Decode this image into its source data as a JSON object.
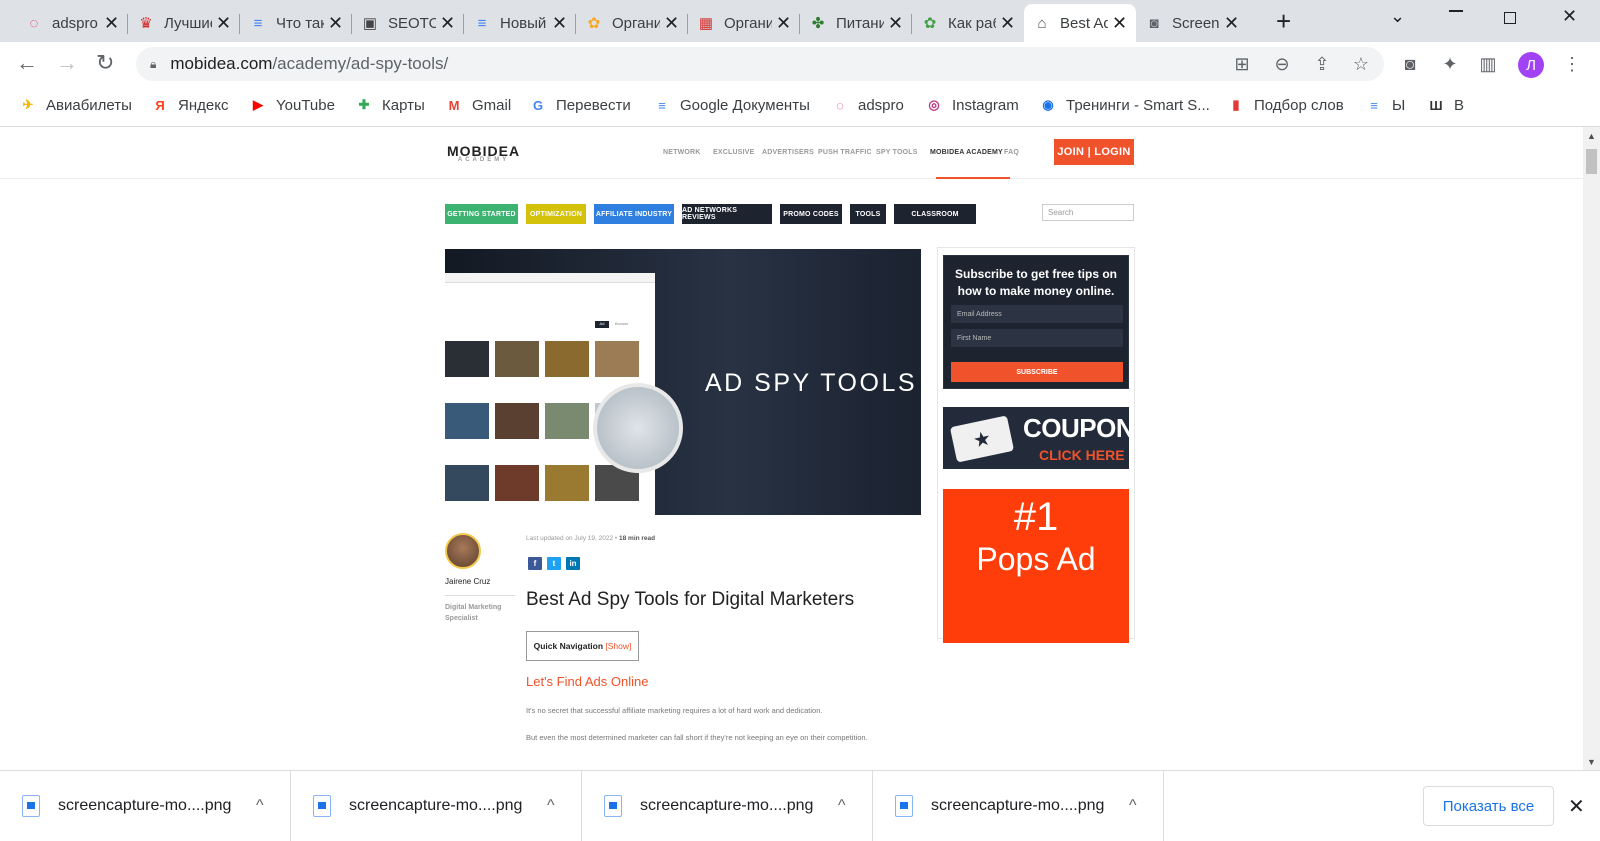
{
  "tabs": [
    {
      "title": "adspro",
      "icon": "adspro-icon"
    },
    {
      "title": "Лучшие",
      "icon": "crown-icon"
    },
    {
      "title": "Что такое",
      "icon": "docs-icon"
    },
    {
      "title": "SEOTOOL",
      "icon": "seo-icon"
    },
    {
      "title": "Новый документ",
      "icon": "docs-icon"
    },
    {
      "title": "Организация",
      "icon": "cake-icon"
    },
    {
      "title": "Организатор",
      "icon": "news-icon"
    },
    {
      "title": "Питание",
      "icon": "people-icon"
    },
    {
      "title": "Как работает",
      "icon": "plant-icon"
    },
    {
      "title": "Best Ad Spy Tools",
      "icon": "mobidea-icon"
    },
    {
      "title": "Screenshot",
      "icon": "camera-icon"
    }
  ],
  "address": {
    "host": "mobidea.com",
    "path": "/academy/ad-spy-tools/"
  },
  "profile_initial": "Л",
  "bookmarks": [
    {
      "label": "Авиабилеты",
      "icon": "plane-icon",
      "color": "#f4b400",
      "glyph": "✈"
    },
    {
      "label": "Яндекс",
      "icon": "yandex-icon",
      "color": "#fc3f1d",
      "glyph": "Я"
    },
    {
      "label": "YouTube",
      "icon": "youtube-icon",
      "color": "#ff0000",
      "glyph": "▶"
    },
    {
      "label": "Карты",
      "icon": "maps-icon",
      "color": "#34a853",
      "glyph": "✚"
    },
    {
      "label": "Gmail",
      "icon": "gmail-icon",
      "color": "#ea4335",
      "glyph": "M"
    },
    {
      "label": "Перевести",
      "icon": "translate-icon",
      "color": "#4285f4",
      "glyph": "G"
    },
    {
      "label": "Google Документы",
      "icon": "docs-icon",
      "color": "#4285f4",
      "glyph": "≡"
    },
    {
      "label": "adspro",
      "icon": "adspro-icon",
      "color": "#e91e63",
      "glyph": "◌"
    },
    {
      "label": "Instagram",
      "icon": "instagram-icon",
      "color": "#c13584",
      "glyph": "◎"
    },
    {
      "label": "Тренинги - Smart S...",
      "icon": "location-icon",
      "color": "#1a73e8",
      "glyph": "◉"
    },
    {
      "label": "Подбор слов",
      "icon": "bars-icon",
      "color": "#e53935",
      "glyph": "▮"
    },
    {
      "label": "Ы",
      "icon": "docs-icon",
      "color": "#4285f4",
      "glyph": "≡"
    },
    {
      "label": "В",
      "icon": "trident-icon",
      "color": "#333333",
      "glyph": "Ш"
    }
  ],
  "site": {
    "logo": "MOBIDEA",
    "logo_sub": "ACADEMY",
    "nav": [
      "NETWORK",
      "EXCLUSIVE",
      "ADVERTISERS",
      "PUSH TRAFFIC",
      "SPY TOOLS",
      "MOBIDEA ACADEMY",
      "FAQ"
    ],
    "join_label": "JOIN | LOGIN",
    "categories": [
      {
        "label": "GETTING STARTED",
        "color": "#3cb371"
      },
      {
        "label": "OPTIMIZATION",
        "color": "#d4c10a"
      },
      {
        "label": "AFFILIATE INDUSTRY",
        "color": "#2f7fe0"
      },
      {
        "label": "AD NETWORKS REVIEWS",
        "color": "#1e2330"
      },
      {
        "label": "PROMO CODES",
        "color": "#1e2330"
      },
      {
        "label": "TOOLS",
        "color": "#1e2330"
      },
      {
        "label": "CLASSROOM",
        "color": "#1e2330"
      }
    ],
    "search_placeholder": "Search"
  },
  "hero": {
    "title": "AD SPY TOOLS",
    "panel_tab_active": "Ad",
    "panel_tab_other": "Browse"
  },
  "sidebar": {
    "subscribe_text": "Subscribe to get free tips on how to make money online.",
    "email_placeholder": "Email Address",
    "firstname_placeholder": "First Name",
    "subscribe_button": "SUBSCRIBE",
    "coupons_title": "COUPONS",
    "coupons_sub": "CLICK HERE",
    "pops_rank": "#1",
    "pops_text": "Pops Ad"
  },
  "article": {
    "author_name": "Jairene Cruz",
    "author_role": "Digital Marketing Specialist",
    "updated_prefix": "Last updated on July 19, 2022",
    "read_time": "18 min read",
    "title": "Best Ad Spy Tools for Digital Marketers",
    "quick_nav": "Quick Navigation",
    "quick_nav_show": "[Show]",
    "section_heading": "Let's Find Ads Online",
    "para1": "It's no secret that successful affiliate marketing requires a lot of hard work and dedication.",
    "para2": "But even the most determined marketer can fall short if they're not keeping an eye on their competition."
  },
  "downloads": {
    "files": [
      "screencapture-mo....png",
      "screencapture-mo....png",
      "screencapture-mo....png",
      "screencapture-mo....png"
    ],
    "show_all": "Показать все"
  }
}
